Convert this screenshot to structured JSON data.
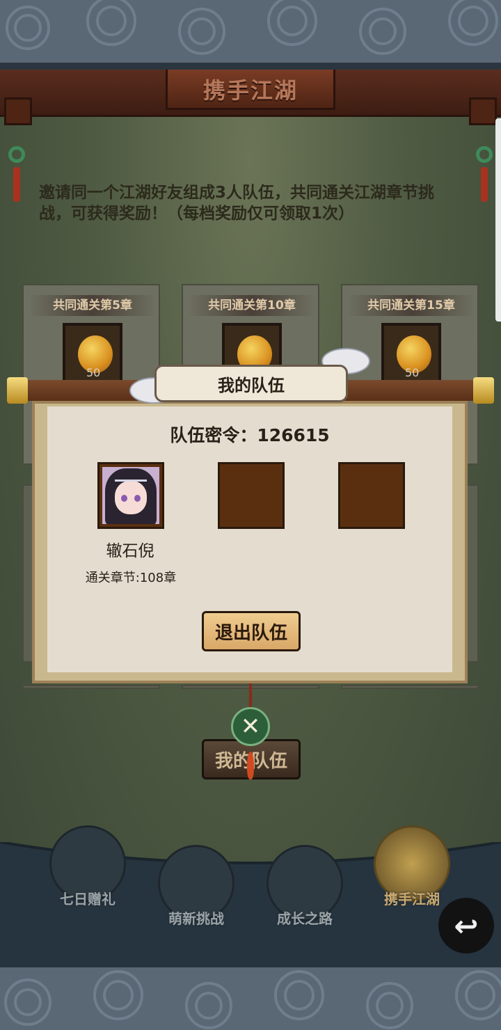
{
  "header": {
    "title": "携手江湖"
  },
  "intro_text": "邀请同一个江湖好友组成3人队伍，共同通关江湖章节挑战，可获得奖励！（每档奖励仅可领取1次）",
  "reward_cards": [
    {
      "title": "共同通关第5章",
      "icon": "gourd-icon",
      "count": "50"
    },
    {
      "title": "共同通关第10章",
      "icon": "gourd-icon",
      "count": ""
    },
    {
      "title": "共同通关第15章",
      "icon": "gourd-icon",
      "count": "50"
    }
  ],
  "modal": {
    "title": "我的队伍",
    "team_code_label": "队伍密令：126615",
    "member": {
      "name": "辙石倪",
      "level": "通关章节:108章"
    },
    "leave_button": "退出队伍",
    "close_icon": "close-x-icon"
  },
  "bottom_button": "我的队伍",
  "nav": [
    {
      "label": "七日赠礼",
      "icon": "gift-box-icon",
      "active": false
    },
    {
      "label": "萌新挑战",
      "icon": "monster-icon",
      "active": false
    },
    {
      "label": "成长之路",
      "icon": "book-arrow-icon",
      "active": false
    },
    {
      "label": "携手江湖",
      "icon": "handshake-icon",
      "active": true
    }
  ],
  "back_icon": "back-arrow-icon",
  "colors": {
    "title_bar": "#4e2414",
    "panel": "#4e5a42",
    "modal_bg": "#e4ddcf",
    "button": "#d8a868"
  }
}
